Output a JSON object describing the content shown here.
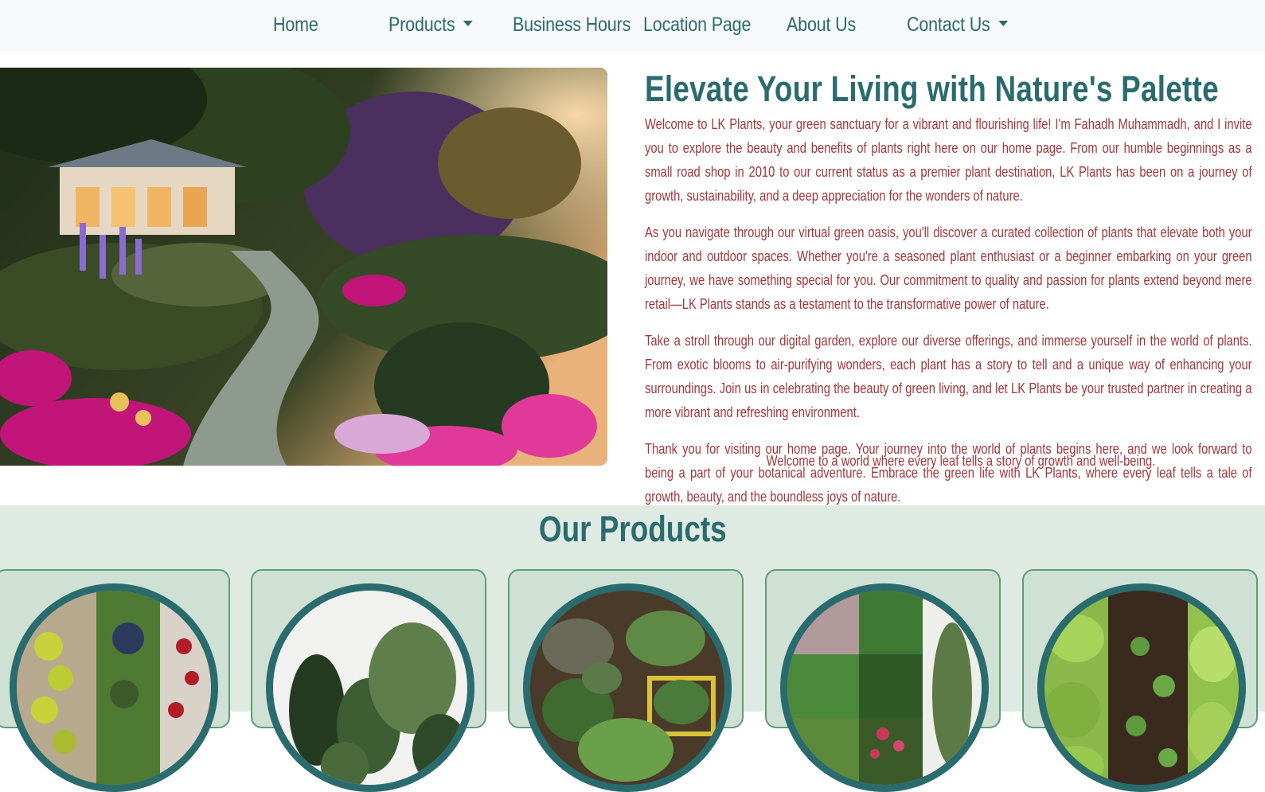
{
  "nav": {
    "items": [
      {
        "label": "Home",
        "dropdown": false
      },
      {
        "label": "Products",
        "dropdown": true
      },
      {
        "label": "Business Hours",
        "dropdown": false
      },
      {
        "label": "Location Page",
        "dropdown": false
      },
      {
        "label": "About Us",
        "dropdown": false
      },
      {
        "label": "Contact Us",
        "dropdown": true
      }
    ]
  },
  "hero": {
    "title": "Elevate Your Living with Nature's Palette",
    "paragraphs": [
      "Welcome to LK Plants, your green sanctuary for a vibrant and flourishing life! I'm Fahadh Muhammadh, and I invite you to explore the beauty and benefits of plants right here on our home page. From our humble beginnings as a small road shop in 2010 to our current status as a premier plant destination, LK Plants has been on a journey of growth, sustainability, and a deep appreciation for the wonders of nature.",
      "As you navigate through our virtual green oasis, you'll discover a curated collection of plants that elevate both your indoor and outdoor spaces. Whether you're a seasoned plant enthusiast or a beginner embarking on your green journey, we have something special for you. Our commitment to quality and passion for plants extend beyond mere retail—LK Plants stands as a testament to the transformative power of nature.",
      "Take a stroll through our digital garden, explore our diverse offerings, and immerse yourself in the world of plants. From exotic blooms to air-purifying wonders, each plant has a story to tell and a unique way of enhancing your surroundings. Join us in celebrating the beauty of green living, and let LK Plants be your trusted partner in creating a more vibrant and refreshing environment.",
      "Thank you for visiting our home page. Your journey into the world of plants begins here, and we look forward to being a part of your botanical adventure. Embrace the green life with LK Plants, where every leaf tells a tale of growth, beauty, and the boundless joys of nature."
    ],
    "tagline": "Welcome to a world where every leaf tells a story of growth and well-being."
  },
  "products": {
    "title": "Our Products",
    "cards": [
      {
        "icon": "fruit-plants-image"
      },
      {
        "icon": "indoor-plants-image"
      },
      {
        "icon": "herb-plants-image"
      },
      {
        "icon": "medicinal-plants-image"
      },
      {
        "icon": "vegetable-seedlings-image"
      }
    ]
  },
  "colors": {
    "brand": "#2a6b6e",
    "body_text": "#a0383c",
    "section_bg": "#dfeae2",
    "card_bg": "#cfe1d4",
    "nav_bg": "#f8f9fa"
  }
}
